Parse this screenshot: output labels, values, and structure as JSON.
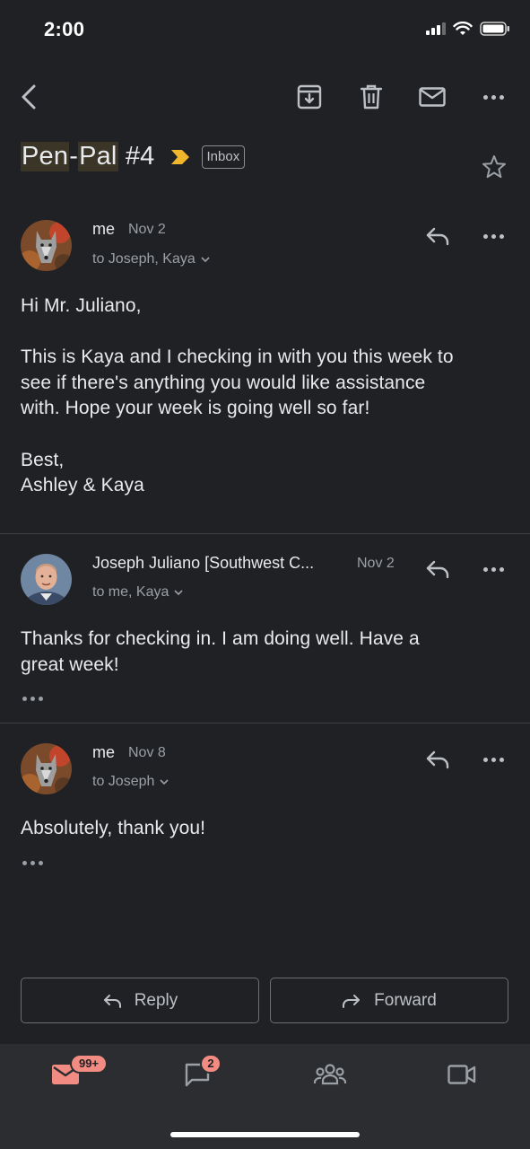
{
  "status_bar": {
    "time": "2:00"
  },
  "subject": {
    "part1": "Pen",
    "dash": "-",
    "part2": "Pal",
    "rest": " #4",
    "label": "Inbox"
  },
  "messages": [
    {
      "sender": "me",
      "date": "Nov 2",
      "recipients": "to Joseph, Kaya",
      "body": [
        "Hi Mr. Juliano,",
        "",
        "This is Kaya and I checking in with you this week to",
        "see if there's anything you would like assistance",
        "with. Hope your week is going well so far!",
        "",
        "Best,",
        "Ashley & Kaya"
      ]
    },
    {
      "sender": "Joseph Juliano [Southwest C...",
      "date": "Nov 2",
      "recipients": "to me, Kaya",
      "body": [
        "Thanks for checking in. I am doing well. Have a",
        "great week!"
      ]
    },
    {
      "sender": "me",
      "date": "Nov 8",
      "recipients": "to Joseph",
      "body": [
        "Absolutely, thank you!"
      ]
    }
  ],
  "actions": {
    "reply": "Reply",
    "forward": "Forward"
  },
  "bottom_nav": {
    "mail_badge": "99+",
    "chat_badge": "2"
  },
  "colors": {
    "background": "#202124",
    "badge": "#f28b82",
    "importance": "#f2b62d",
    "nav_background": "#2c2d30"
  }
}
